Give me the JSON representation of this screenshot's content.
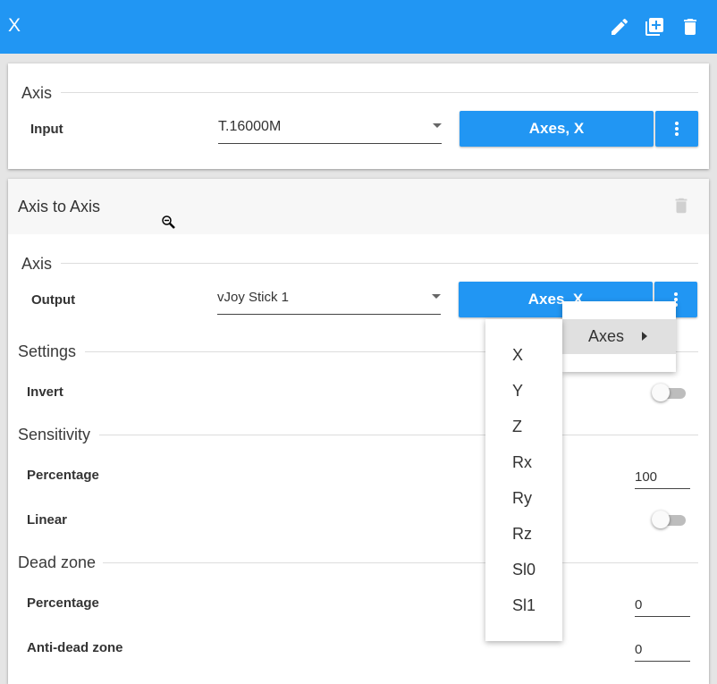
{
  "window": {
    "title": "X"
  },
  "topbar_actions": [
    {
      "name": "edit",
      "icon": "pencil-icon"
    },
    {
      "name": "duplicate",
      "icon": "add-box-icon"
    },
    {
      "name": "delete",
      "icon": "trash-icon"
    }
  ],
  "input_card": {
    "section": "Axis",
    "input_label": "Input",
    "device_value": "T.16000M",
    "axis_button": "Axes, X"
  },
  "action_card": {
    "title": "Axis to Axis",
    "axis_section": "Axis",
    "output_label": "Output",
    "device_value": "vJoy Stick 1",
    "axis_button": "Axes, X",
    "settings_section": "Settings",
    "invert_label": "Invert",
    "sensitivity_section": "Sensitivity",
    "sensitivity_percentage_label": "Percentage",
    "sensitivity_percentage_value": "100",
    "linear_label": "Linear",
    "deadzone_section": "Dead zone",
    "deadzone_percentage_label": "Percentage",
    "deadzone_percentage_value": "0",
    "antideadzone_label": "Anti-dead zone",
    "antideadzone_value": "0"
  },
  "axes_menu": {
    "item_label": "Axes"
  },
  "axes_submenu": {
    "items": [
      "X",
      "Y",
      "Z",
      "Rx",
      "Ry",
      "Rz",
      "Sl0",
      "Sl1"
    ]
  },
  "colors": {
    "primary": "#2196f3",
    "topbar_text": "#ffffff",
    "page_background": "#e5e5e5",
    "toggle_track_off": "#bdbdbd"
  }
}
